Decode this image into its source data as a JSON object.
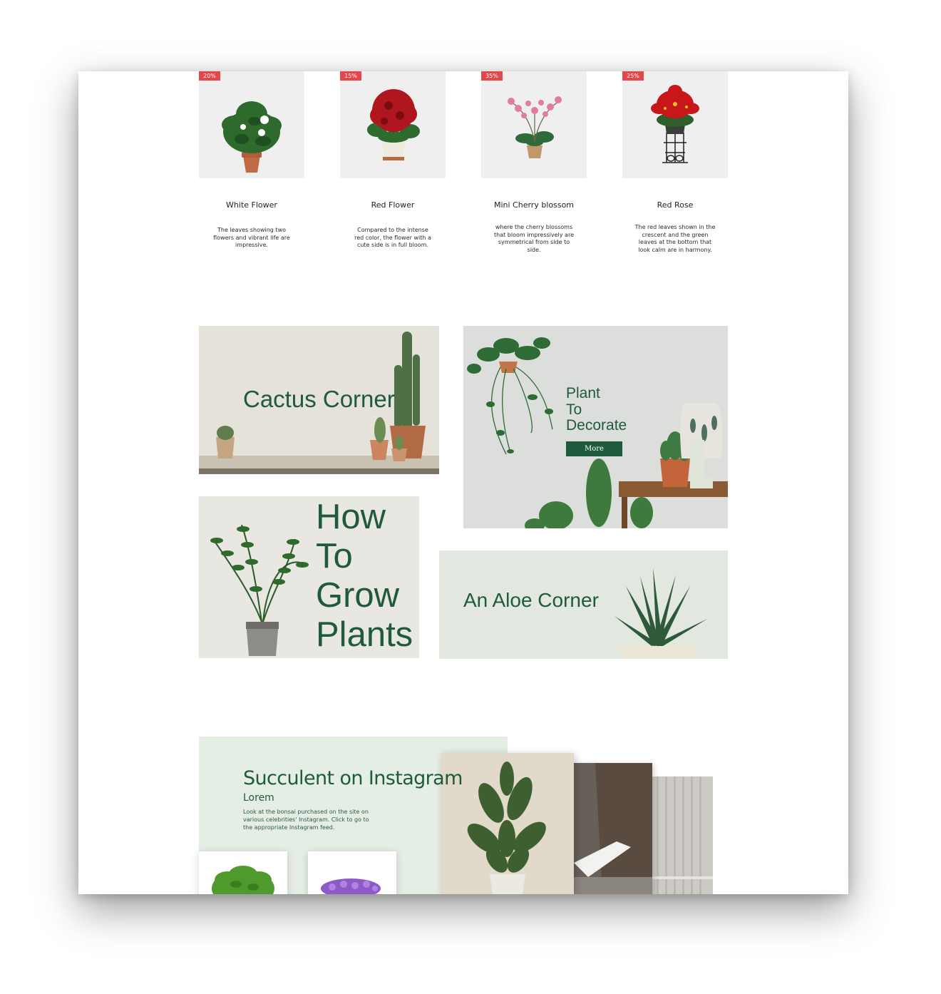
{
  "products": [
    {
      "discount": "20%",
      "name": "White Flower",
      "description": "The leaves showing two flowers and vibrant life are impressive."
    },
    {
      "discount": "15%",
      "name": "Red Flower",
      "description": "Compared to the intense red color, the flower with a cute side is in full bloom."
    },
    {
      "discount": "35%",
      "name": "Mini Cherry blossom",
      "description": "where the cherry blossoms that bloom impressively are symmetrical from side to side."
    },
    {
      "discount": "25%",
      "name": "Red Rose",
      "description": "The red leaves shown in the crescent and the green leaves at the bottom that look calm are in harmony."
    }
  ],
  "banners": {
    "cactus": {
      "title": "Cactus Corner"
    },
    "decorate": {
      "title_lines": [
        "Plant",
        "To",
        "Decorate"
      ],
      "button_label": "More"
    },
    "grow": {
      "title_lines": [
        "How",
        "To",
        "Grow",
        "Plants"
      ]
    },
    "aloe": {
      "title": "An Aloe Corner"
    }
  },
  "instagram": {
    "title": "Succulent on Instagram",
    "subtitle": "Lorem",
    "description": "Look at the bonsai purchased on the site on various celebrities' Instagram. Click to go to the appropriate Instagram feed."
  },
  "colors": {
    "brand_green": "#1f5a3a",
    "badge_red": "#e2484a",
    "card_bg": "#efefef",
    "insta_bg": "#e5eee4"
  }
}
